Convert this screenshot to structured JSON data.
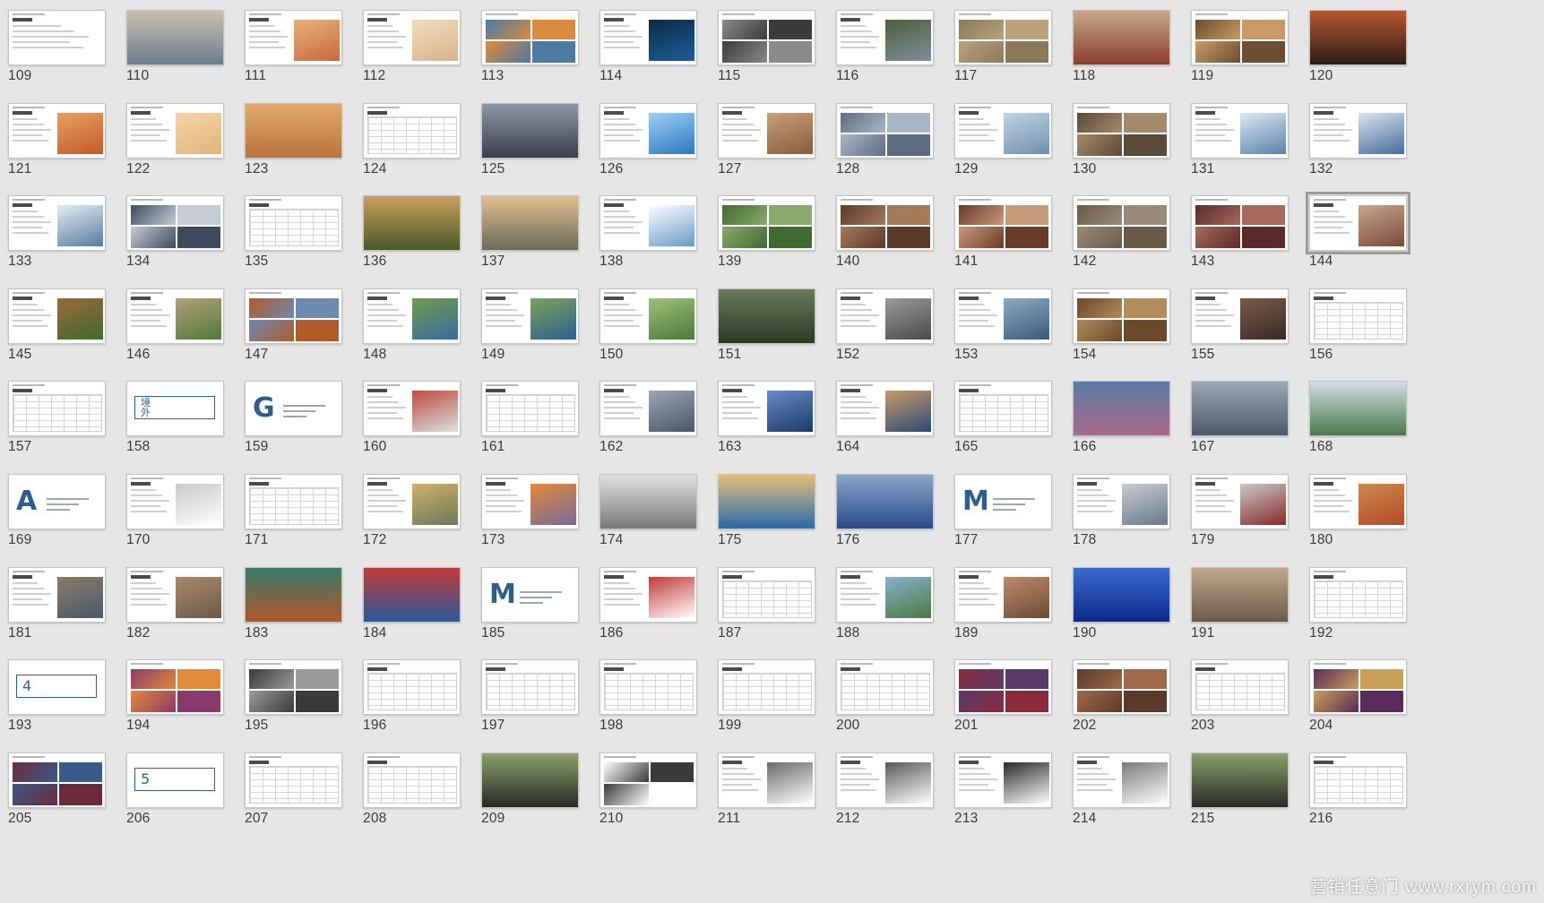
{
  "slide_sorter": {
    "selected_slide": "144",
    "slides": [
      {
        "n": "109",
        "k": "text",
        "c": "#ffffff"
      },
      {
        "n": "110",
        "k": "photo",
        "c": "#6d7d8c",
        "c2": "#c8c2b0"
      },
      {
        "n": "111",
        "k": "split",
        "c": "#c9693a",
        "c2": "#e9b07a"
      },
      {
        "n": "112",
        "k": "split",
        "c": "#d8b38a",
        "c2": "#f0dcc0"
      },
      {
        "n": "113",
        "k": "collage",
        "c": "#4d7ba3",
        "c2": "#d98a3b"
      },
      {
        "n": "114",
        "k": "split",
        "c": "#1d5e9b",
        "c2": "#0c2a45"
      },
      {
        "n": "115",
        "k": "collage",
        "c": "#8a8a8a",
        "c2": "#3b3b3b"
      },
      {
        "n": "116",
        "k": "split",
        "c": "#7f8f9f",
        "c2": "#4f5d3a"
      },
      {
        "n": "117",
        "k": "collage",
        "c": "#8b7a5a",
        "c2": "#b7a27a"
      },
      {
        "n": "118",
        "k": "photo",
        "c": "#8a3e2e",
        "c2": "#c7a98a"
      },
      {
        "n": "119",
        "k": "collage",
        "c": "#6b4e32",
        "c2": "#c99b62"
      },
      {
        "n": "120",
        "k": "photo",
        "c": "#2a1d18",
        "c2": "#b8582e"
      },
      {
        "n": "121",
        "k": "split",
        "c": "#c45a2a",
        "c2": "#e8a060"
      },
      {
        "n": "122",
        "k": "split",
        "c": "#e4b47a",
        "c2": "#f3d3a6"
      },
      {
        "n": "123",
        "k": "photo",
        "c": "#b8743e",
        "c2": "#e2a86c"
      },
      {
        "n": "124",
        "k": "table",
        "c": "#ffffff"
      },
      {
        "n": "125",
        "k": "photo",
        "c": "#3a3f4a",
        "c2": "#8d97a8"
      },
      {
        "n": "126",
        "k": "split",
        "c": "#2b77c2",
        "c2": "#9fd0f2"
      },
      {
        "n": "127",
        "k": "split",
        "c": "#8a5a3a",
        "c2": "#c8a07a"
      },
      {
        "n": "128",
        "k": "collage",
        "c": "#5d6d80",
        "c2": "#aab6c4"
      },
      {
        "n": "129",
        "k": "split",
        "c": "#6f8fae",
        "c2": "#c0d4e4"
      },
      {
        "n": "130",
        "k": "collage",
        "c": "#5a4a3a",
        "c2": "#a58a6a"
      },
      {
        "n": "131",
        "k": "split",
        "c": "#5a82aa",
        "c2": "#dce8f2"
      },
      {
        "n": "132",
        "k": "split",
        "c": "#4a6a9a",
        "c2": "#d8e4ee"
      },
      {
        "n": "133",
        "k": "split",
        "c": "#5a7aa0",
        "c2": "#e4ecf4"
      },
      {
        "n": "134",
        "k": "collage",
        "c": "#3d4b5c",
        "c2": "#c6ccd6"
      },
      {
        "n": "135",
        "k": "table",
        "c": "#ffffff"
      },
      {
        "n": "136",
        "k": "photo",
        "c": "#4a5a2a",
        "c2": "#c9a05a"
      },
      {
        "n": "137",
        "k": "photo",
        "c": "#6a6a5a",
        "c2": "#e0c090"
      },
      {
        "n": "138",
        "k": "split",
        "c": "#6a9ac8",
        "c2": "#ffffff"
      },
      {
        "n": "139",
        "k": "collage",
        "c": "#3f6a32",
        "c2": "#8aa96a"
      },
      {
        "n": "140",
        "k": "collage",
        "c": "#5a3a2a",
        "c2": "#a57a5a"
      },
      {
        "n": "141",
        "k": "collage",
        "c": "#6a3a2a",
        "c2": "#c89a7a"
      },
      {
        "n": "142",
        "k": "collage",
        "c": "#6a5a4a",
        "c2": "#9a8a7a"
      },
      {
        "n": "143",
        "k": "collage",
        "c": "#5a2a2a",
        "c2": "#a56a5a"
      },
      {
        "n": "144",
        "k": "split",
        "c": "#7a4a3a",
        "c2": "#c8a68a"
      },
      {
        "n": "145",
        "k": "split",
        "c": "#3f6a2f",
        "c2": "#9a6a3a"
      },
      {
        "n": "146",
        "k": "split",
        "c": "#4f7a3a",
        "c2": "#b3a07a"
      },
      {
        "n": "147",
        "k": "collage",
        "c": "#b25a2a",
        "c2": "#6a8ab0"
      },
      {
        "n": "148",
        "k": "split",
        "c": "#3a6aa0",
        "c2": "#6f9a4a"
      },
      {
        "n": "149",
        "k": "split",
        "c": "#2f5f8f",
        "c2": "#7aa05a"
      },
      {
        "n": "150",
        "k": "split",
        "c": "#4a7a3a",
        "c2": "#a0c07a"
      },
      {
        "n": "151",
        "k": "photo",
        "c": "#2a3a24",
        "c2": "#6a7a5a"
      },
      {
        "n": "152",
        "k": "split",
        "c": "#4a4a4a",
        "c2": "#9a9a9a"
      },
      {
        "n": "153",
        "k": "split",
        "c": "#3a5a7a",
        "c2": "#8aaac4"
      },
      {
        "n": "154",
        "k": "collage",
        "c": "#6a4a2a",
        "c2": "#b38a5a"
      },
      {
        "n": "155",
        "k": "split",
        "c": "#3a2a2a",
        "c2": "#7a5a4a"
      },
      {
        "n": "156",
        "k": "table",
        "c": "#ffffff"
      },
      {
        "n": "157",
        "k": "table",
        "c": "#ffffff"
      },
      {
        "n": "158",
        "k": "box",
        "c": "#ffffff"
      },
      {
        "n": "159",
        "k": "letter",
        "letter": "G",
        "c": "#ffffff"
      },
      {
        "n": "160",
        "k": "split",
        "c": "#d8e0e8",
        "c2": "#c04a3a"
      },
      {
        "n": "161",
        "k": "table",
        "c": "#ffffff"
      },
      {
        "n": "162",
        "k": "split",
        "c": "#4a5666",
        "c2": "#9aa6b6"
      },
      {
        "n": "163",
        "k": "split",
        "c": "#1a3a6a",
        "c2": "#6a8ac8"
      },
      {
        "n": "164",
        "k": "split",
        "c": "#2a4a7a",
        "c2": "#c89a6a"
      },
      {
        "n": "165",
        "k": "table",
        "c": "#ffffff"
      },
      {
        "n": "166",
        "k": "photo",
        "c": "#a86a8a",
        "c2": "#5a7aa4"
      },
      {
        "n": "167",
        "k": "photo",
        "c": "#4a5a6a",
        "c2": "#9aa8b6"
      },
      {
        "n": "168",
        "k": "photo",
        "c": "#4a7a4a",
        "c2": "#d4dce4"
      },
      {
        "n": "169",
        "k": "letter",
        "letter": "A",
        "c": "#ffffff"
      },
      {
        "n": "170",
        "k": "split",
        "c": "#ffffff",
        "c2": "#c9c9c9"
      },
      {
        "n": "171",
        "k": "table",
        "c": "#ffffff"
      },
      {
        "n": "172",
        "k": "split",
        "c": "#6a7a5a",
        "c2": "#d0b06a"
      },
      {
        "n": "173",
        "k": "split",
        "c": "#7a6a9a",
        "c2": "#e08a3a"
      },
      {
        "n": "174",
        "k": "photo",
        "c": "#7a7a7a",
        "c2": "#e0e0e0"
      },
      {
        "n": "175",
        "k": "photo",
        "c": "#2a6aaa",
        "c2": "#e0c07a"
      },
      {
        "n": "176",
        "k": "photo",
        "c": "#2a4a8a",
        "c2": "#8aa6c8"
      },
      {
        "n": "177",
        "k": "letter",
        "letter": "M",
        "c": "#ffffff"
      },
      {
        "n": "178",
        "k": "split",
        "c": "#6a7a8a",
        "c2": "#c8ccd0"
      },
      {
        "n": "179",
        "k": "split",
        "c": "#8a2a2a",
        "c2": "#c8c8c8"
      },
      {
        "n": "180",
        "k": "split",
        "c": "#b04a2a",
        "c2": "#d0894a"
      },
      {
        "n": "181",
        "k": "split",
        "c": "#4a5a6a",
        "c2": "#8a7a6a"
      },
      {
        "n": "182",
        "k": "split",
        "c": "#6a5a4a",
        "c2": "#aa8a6a"
      },
      {
        "n": "183",
        "k": "photo",
        "c": "#b0582a",
        "c2": "#3a7a6a"
      },
      {
        "n": "184",
        "k": "photo",
        "c": "#2a5a9a",
        "c2": "#c03a3a"
      },
      {
        "n": "185",
        "k": "letter",
        "letter": "M",
        "c": "#ffffff"
      },
      {
        "n": "186",
        "k": "split",
        "c": "#ffffff",
        "c2": "#c03a3a"
      },
      {
        "n": "187",
        "k": "table",
        "c": "#ffffff"
      },
      {
        "n": "188",
        "k": "split",
        "c": "#4a7a3a",
        "c2": "#8ab0d0"
      },
      {
        "n": "189",
        "k": "split",
        "c": "#6a4a3a",
        "c2": "#c08a6a"
      },
      {
        "n": "190",
        "k": "photo",
        "c": "#0a2a8a",
        "c2": "#3a6ad0"
      },
      {
        "n": "191",
        "k": "photo",
        "c": "#6a5a4a",
        "c2": "#c0a88a"
      },
      {
        "n": "192",
        "k": "table",
        "c": "#ffffff"
      },
      {
        "n": "193",
        "k": "box",
        "c": "#ffffff"
      },
      {
        "n": "194",
        "k": "collage",
        "c": "#8a3a6a",
        "c2": "#e08a3a"
      },
      {
        "n": "195",
        "k": "collage",
        "c": "#3a3a3a",
        "c2": "#9a9a9a"
      },
      {
        "n": "196",
        "k": "table",
        "c": "#ffffff"
      },
      {
        "n": "197",
        "k": "table",
        "c": "#ffffff"
      },
      {
        "n": "198",
        "k": "table",
        "c": "#ffffff"
      },
      {
        "n": "199",
        "k": "table",
        "c": "#ffffff"
      },
      {
        "n": "200",
        "k": "table",
        "c": "#ffffff"
      },
      {
        "n": "201",
        "k": "collage",
        "c": "#8a2a3a",
        "c2": "#5a3a6a"
      },
      {
        "n": "202",
        "k": "collage",
        "c": "#5a3a2a",
        "c2": "#a06a4a"
      },
      {
        "n": "203",
        "k": "table",
        "c": "#ffffff"
      },
      {
        "n": "204",
        "k": "collage",
        "c": "#5a2a5a",
        "c2": "#c8a05a"
      },
      {
        "n": "205",
        "k": "collage",
        "c": "#6a2a3a",
        "c2": "#3a5a8a"
      },
      {
        "n": "206",
        "k": "box",
        "c": "#ffffff"
      },
      {
        "n": "207",
        "k": "table",
        "c": "#ffffff"
      },
      {
        "n": "208",
        "k": "table",
        "c": "#ffffff"
      },
      {
        "n": "209",
        "k": "photo",
        "c": "#2a2a2a",
        "c2": "#8aa06a"
      },
      {
        "n": "210",
        "k": "collage",
        "c": "#ffffff",
        "c2": "#3a3a3a"
      },
      {
        "n": "211",
        "k": "split",
        "c": "#ffffff",
        "c2": "#6a6a6a"
      },
      {
        "n": "212",
        "k": "split",
        "c": "#ffffff",
        "c2": "#5a5a5a"
      },
      {
        "n": "213",
        "k": "split",
        "c": "#ffffff",
        "c2": "#2a2a2a"
      },
      {
        "n": "214",
        "k": "split",
        "c": "#ffffff",
        "c2": "#7a7a7a"
      },
      {
        "n": "215",
        "k": "photo",
        "c": "#2a2a2a",
        "c2": "#8aa06a"
      },
      {
        "n": "216",
        "k": "table",
        "c": "#ffffff"
      }
    ],
    "letters": {
      "G": "G",
      "A": "A",
      "M": "M"
    },
    "box_numbers": {
      "193": "4",
      "206": "5"
    },
    "box_158": "境\n外"
  },
  "watermark": {
    "text": "营销任意门 www.rxrym.com"
  }
}
